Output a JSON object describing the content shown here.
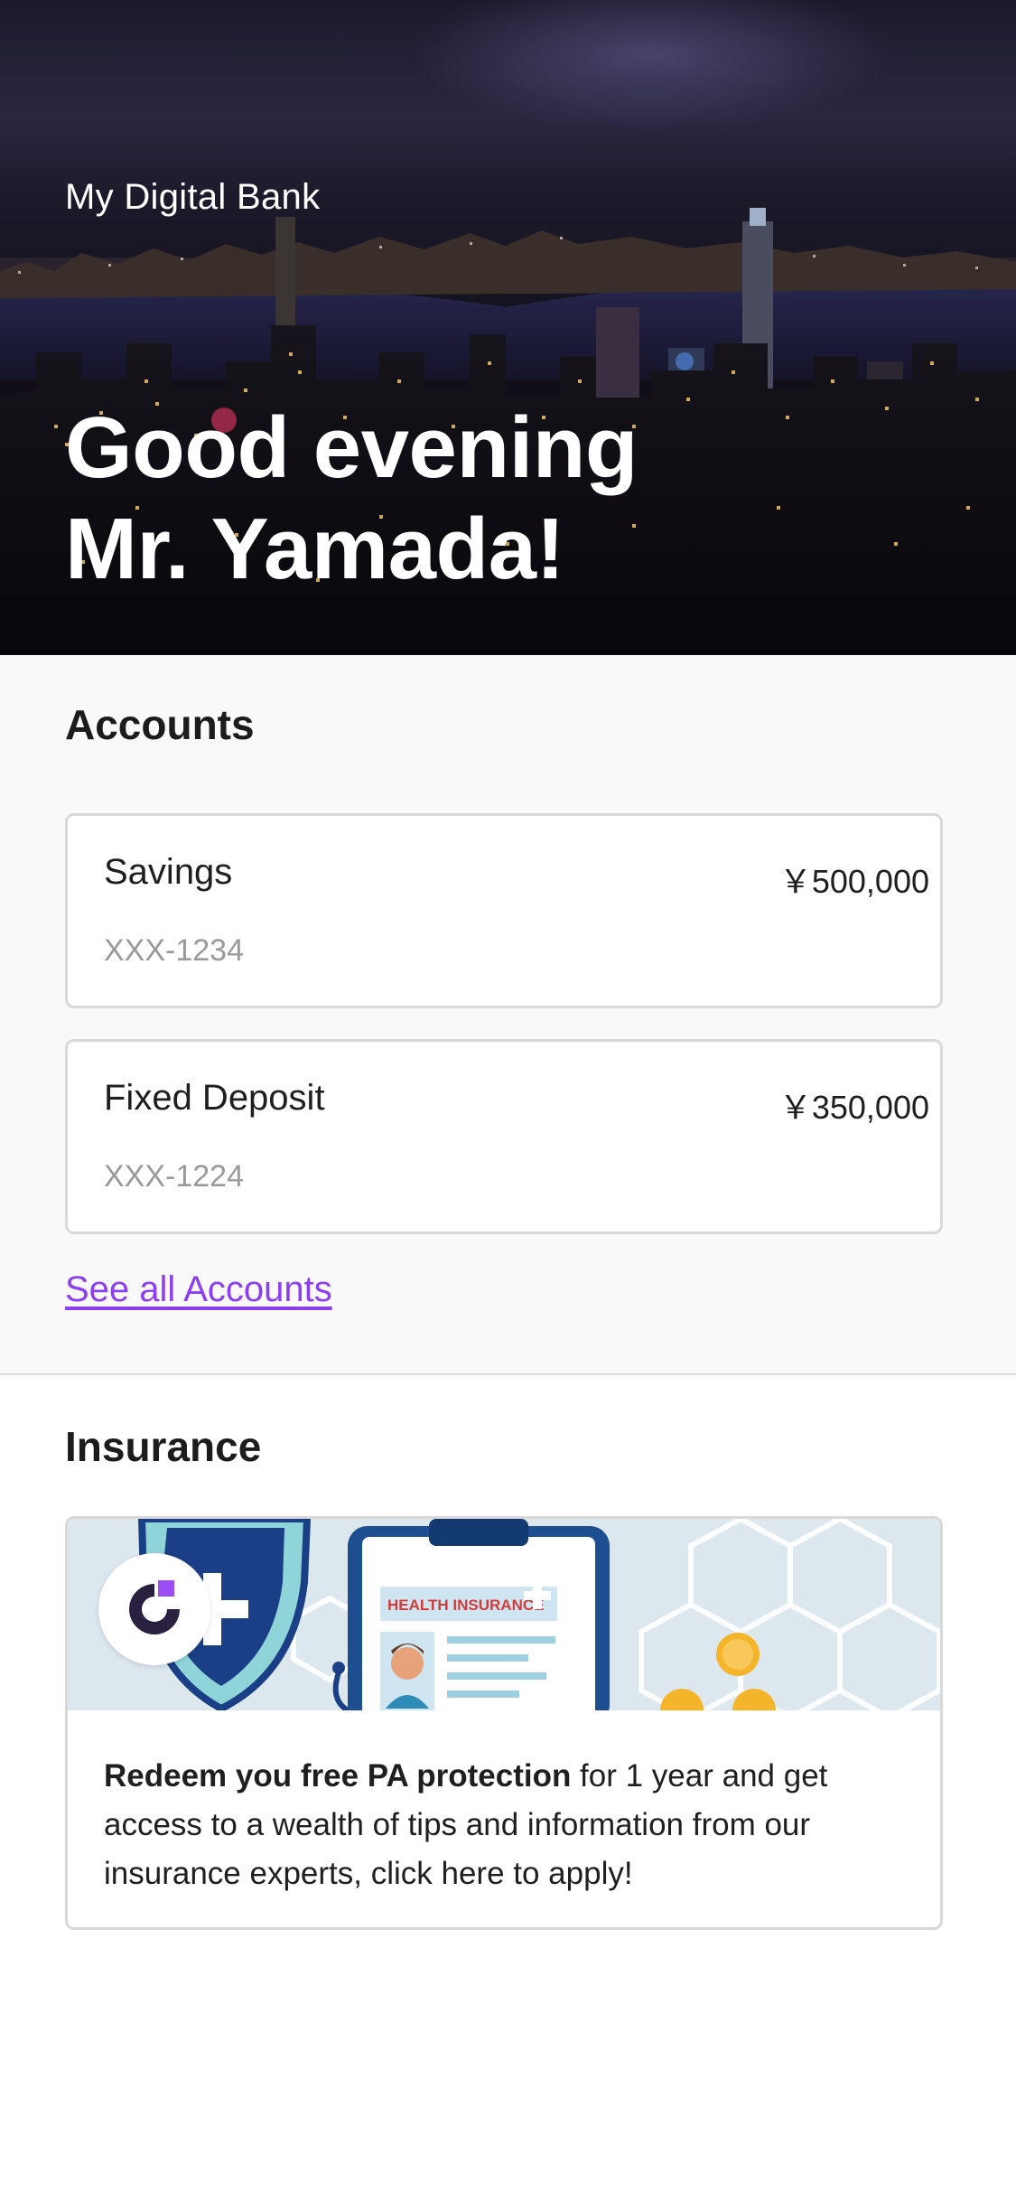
{
  "hero": {
    "brand": "My Digital Bank",
    "greeting_line1": "Good evening",
    "greeting_line2": "Mr. Yamada!"
  },
  "accounts": {
    "title": "Accounts",
    "items": [
      {
        "name": "Savings",
        "number": "XXX-1234",
        "balance": "￥500,000"
      },
      {
        "name": "Fixed Deposit",
        "number": "XXX-1224",
        "balance": "￥350,000"
      }
    ],
    "see_all": "See all Accounts"
  },
  "insurance": {
    "title": "Insurance",
    "banner_label": "HEALTH INSURANCE",
    "promo_bold": "Redeem you free PA protection",
    "promo_rest": " for 1 year and get access to a wealth of tips and information from our insurance experts, click here to apply!"
  },
  "colors": {
    "link": "#8c3ff0",
    "logo_dark": "#2a2040",
    "logo_accent": "#9b4df5",
    "card_border": "#d9d9d9"
  }
}
